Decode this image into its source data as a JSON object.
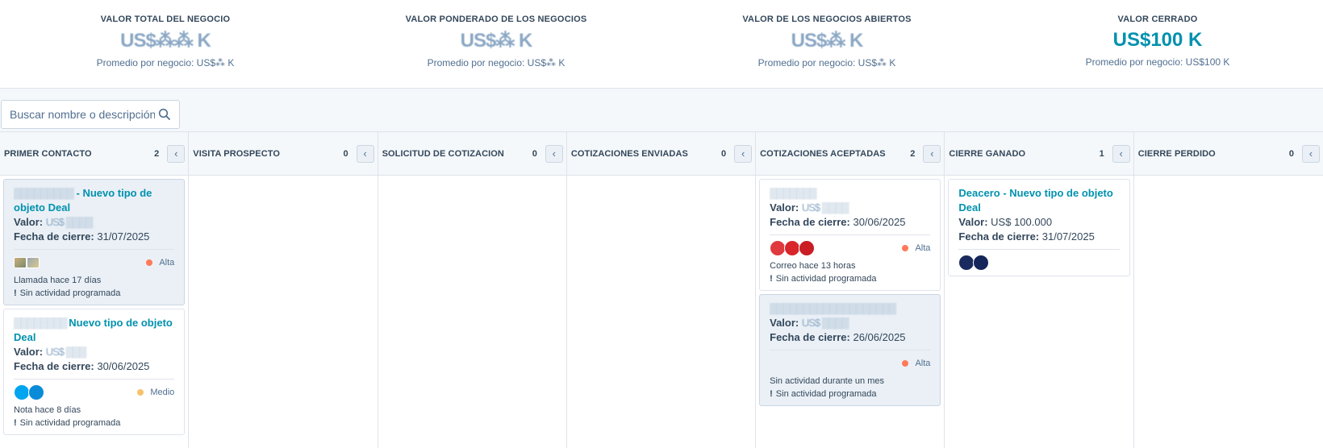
{
  "summary": [
    {
      "label": "VALOR TOTAL DEL NEGOCIO",
      "value": "US$⁂⁂ K",
      "avg": "Promedio por negocio: US$⁂ K"
    },
    {
      "label": "VALOR PONDERADO DE LOS NEGOCIOS",
      "value": "US$⁂ K",
      "avg": "Promedio por negocio: US$⁂ K"
    },
    {
      "label": "VALOR DE LOS NEGOCIOS ABIERTOS",
      "value": "US$⁂ K",
      "avg": "Promedio por negocio: US$⁂ K"
    },
    {
      "label": "VALOR CERRADO",
      "value": "US$100 K",
      "avg": "Promedio por negocio: US$100 K"
    }
  ],
  "search": {
    "placeholder": "Buscar nombre o descripción"
  },
  "columns": [
    {
      "title": "PRIMER CONTACTO",
      "count": "2"
    },
    {
      "title": "VISITA PROSPECTO",
      "count": "0"
    },
    {
      "title": "SOLICITUD DE COTIZACION",
      "count": "0"
    },
    {
      "title": "COTIZACIONES ENVIADAS",
      "count": "0"
    },
    {
      "title": "COTIZACIONES ACEPTADAS",
      "count": "2"
    },
    {
      "title": "CIERRE GANADO",
      "count": "1"
    },
    {
      "title": "CIERRE PERDIDO",
      "count": "0"
    }
  ],
  "labels": {
    "valor": "Valor:",
    "fecha": "Fecha de cierre:",
    "no_activity": "Sin actividad programada"
  },
  "cards": {
    "c1": {
      "title_redacted": "▒▒▒▒▒▒▒▒▒",
      "title": " - Nuevo tipo de objeto Deal",
      "value": "US$ ▒▒▒▒",
      "date": "31/07/2025",
      "priority": "Alta",
      "activity": "Llamada hace 17 días",
      "priority_color": "#ff7a59"
    },
    "c2": {
      "title_redacted": "▒▒▒▒▒▒▒▒ ",
      "title": "Nuevo tipo de objeto Deal",
      "value": "US$ ▒▒▒",
      "date": "30/06/2025",
      "priority": "Medio",
      "activity": "Nota hace 8 días",
      "priority_color": "#f5c26b"
    },
    "c3": {
      "title_redacted": "▒▒▒▒▒▒▒",
      "value": "US$ ▒▒▒▒",
      "date": "30/06/2025",
      "priority": "Alta",
      "activity": "Correo hace 13 horas",
      "priority_color": "#ff7a59"
    },
    "c4": {
      "title_redacted": "▒▒▒▒▒▒▒▒▒▒▒▒▒▒▒▒▒▒▒",
      "value": "US$ ▒▒▒▒",
      "date": "26/06/2025",
      "priority": "Alta",
      "activity": "Sin actividad durante un mes",
      "priority_color": "#ff7a59"
    },
    "c5": {
      "title": "Deacero - Nuevo tipo de objeto Deal",
      "value": "US$ 100.000",
      "date": "31/07/2025"
    }
  },
  "colors": {
    "accent": "#0091ae",
    "text": "#33475b",
    "border": "#dfe3eb"
  }
}
